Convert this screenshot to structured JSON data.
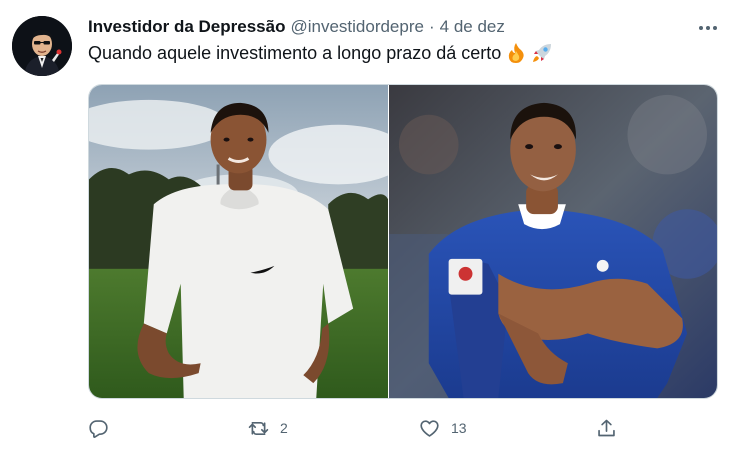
{
  "tweet": {
    "author": {
      "display_name": "Investidor da Depressão",
      "handle": "@investidordepre",
      "avatar_icon": "avatar-cartoon-suit"
    },
    "separator": "·",
    "timestamp": "4 de dez",
    "text": "Quando aquele investimento a longo prazo dá certo",
    "emojis": [
      "fire-emoji",
      "rocket-emoji"
    ],
    "media": [
      {
        "description_icon": "photo-young-player-white-shirt"
      },
      {
        "description_icon": "photo-player-blue-jersey-arms-crossed"
      }
    ],
    "actions": {
      "reply_count": "",
      "retweet_count": "2",
      "like_count": "13",
      "share_count": ""
    }
  },
  "colors": {
    "text_primary": "#0f1419",
    "text_secondary": "#536471",
    "border": "#cfd9de"
  }
}
